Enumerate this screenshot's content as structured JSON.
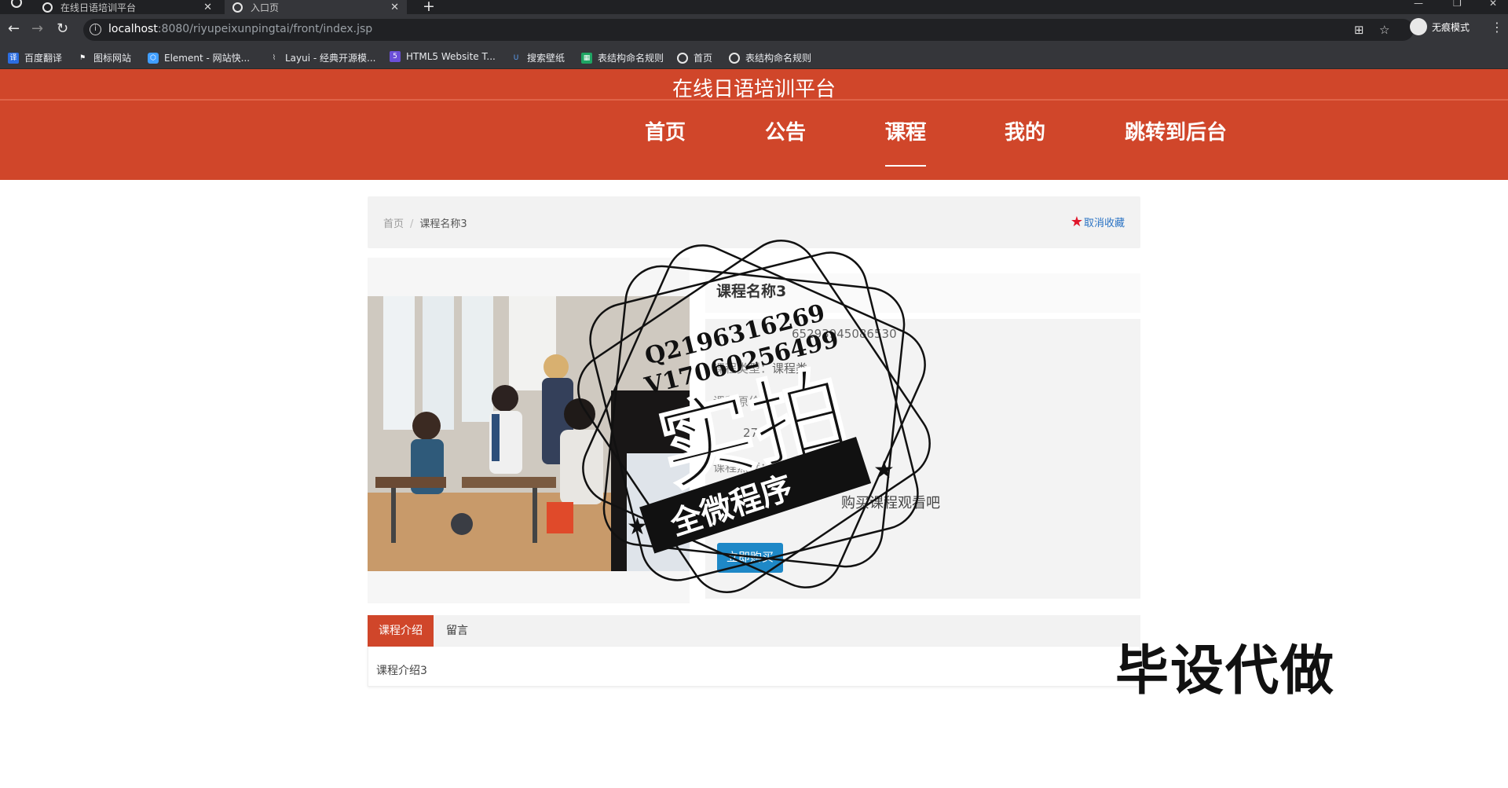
{
  "browser": {
    "tabs": [
      {
        "title": "在线日语培训平台",
        "active": false
      },
      {
        "title": "入口页",
        "active": true
      }
    ],
    "url_host": "localhost",
    "url_path": ":8080/riyupeixunpingtai/front/index.jsp",
    "profile_label": "无痕模式",
    "bookmarks": [
      {
        "label": "百度翻译",
        "icon": "translate-icon"
      },
      {
        "label": "图标网站",
        "icon": "flag-icon"
      },
      {
        "label": "Element - 网站快...",
        "icon": "element-icon"
      },
      {
        "label": "Layui - 经典开源模...",
        "icon": "layui-icon"
      },
      {
        "label": "HTML5 Website T...",
        "icon": "html5-icon"
      },
      {
        "label": "搜索壁纸",
        "icon": "wallpaper-icon"
      },
      {
        "label": "表结构命名规则",
        "icon": "sheet-icon"
      },
      {
        "label": "首页",
        "icon": "globe-icon"
      },
      {
        "label": "表结构命名规则",
        "icon": "globe-icon"
      }
    ]
  },
  "site": {
    "title": "在线日语培训平台",
    "nav": [
      {
        "label": "首页",
        "active": false
      },
      {
        "label": "公告",
        "active": false
      },
      {
        "label": "课程",
        "active": true
      },
      {
        "label": "我的",
        "active": false
      },
      {
        "label": "跳转到后台",
        "active": false
      }
    ]
  },
  "breadcrumb": {
    "home": "首页",
    "separator": "/",
    "current": "课程名称3",
    "favorite_label": "取消收藏"
  },
  "course": {
    "name": "课程名称3",
    "code_partial": "65293945086530",
    "type_label": "课程类型：",
    "type_value": "课程类",
    "price_label": "课程原价：",
    "price_value": "275.6",
    "heat_label": "课程热度：",
    "heat_value": "281",
    "buy_hint": "购买课程观看吧",
    "buy_button": "立即购买"
  },
  "tabs": [
    {
      "label": "课程介绍",
      "active": true
    },
    {
      "label": "留言",
      "active": false
    }
  ],
  "tab_content": "课程介绍3",
  "watermark": {
    "line1": "Q2196316269",
    "line2": "V17060256499",
    "big": "实拍",
    "ribbon": "全微程序",
    "corner": "毕设代做"
  },
  "colors": {
    "header_red": "#d0462a",
    "buy_blue": "#1e88c7",
    "star_red": "#e0162b",
    "link_blue": "#2a73c4"
  }
}
